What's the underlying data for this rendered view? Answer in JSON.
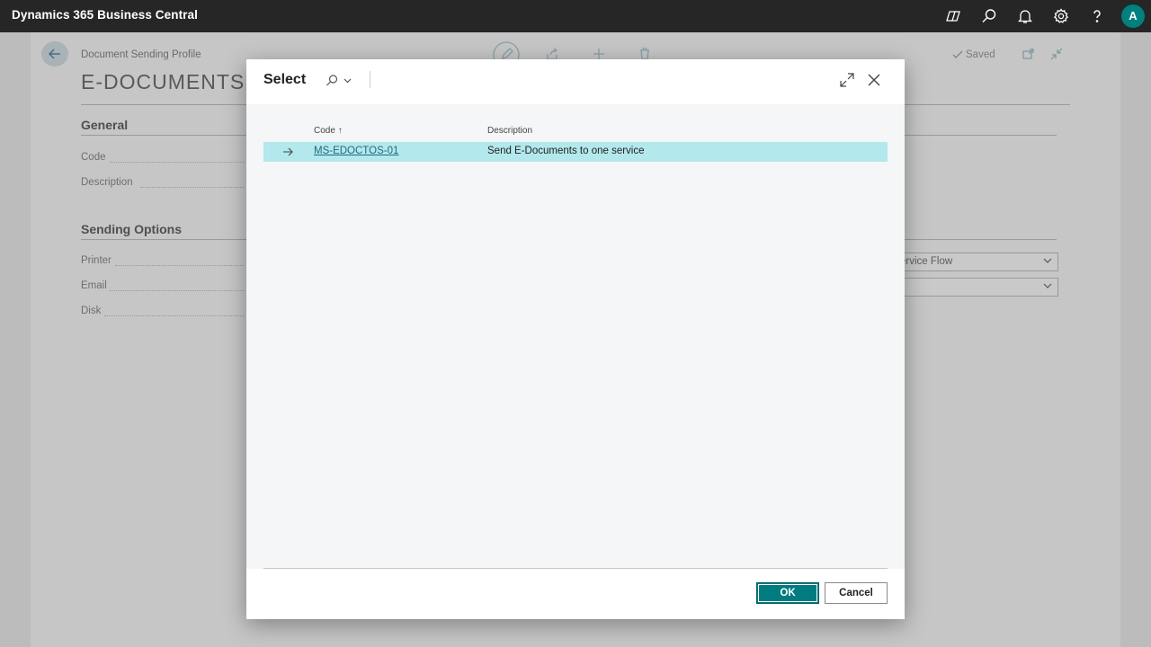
{
  "app": {
    "title": "Dynamics 365 Business Central",
    "avatar_initial": "A"
  },
  "topbar_icons": [
    "copilot-icon",
    "search-icon",
    "bell-icon",
    "settings-icon",
    "help-icon"
  ],
  "background_page": {
    "breadcrumb": "Document Sending Profile",
    "title": "E-DOCUMENTS",
    "saved_label": "Saved",
    "general": {
      "heading": "General",
      "fields": [
        "Code",
        "Description"
      ]
    },
    "sending_options": {
      "heading": "Sending Options",
      "fields": [
        "Printer",
        "Email",
        "Disk"
      ]
    },
    "dropdown_values": [
      "ervice Flow",
      ""
    ]
  },
  "dialog": {
    "title": "Select",
    "columns": {
      "code": "Code",
      "code_sort": "↑",
      "description": "Description"
    },
    "rows": [
      {
        "code": "MS-EDOCTOS-01",
        "description": "Send E-Documents to one service"
      }
    ],
    "ok_label": "OK",
    "cancel_label": "Cancel"
  },
  "colors": {
    "accent": "#007c80",
    "topbar": "#262626",
    "selected_row": "#b3e8ec"
  }
}
